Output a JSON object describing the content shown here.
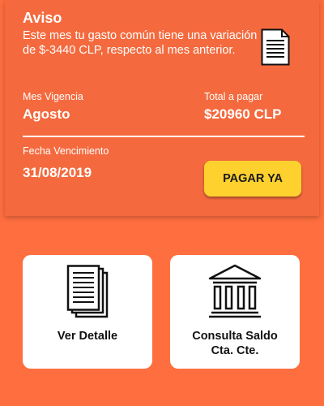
{
  "notice": {
    "title": "Aviso",
    "message": "Este mes tu gasto común tiene una variación de $-3440 CLP, respecto al mes anterior."
  },
  "billing": {
    "month_label": "Mes Vigencia",
    "month_value": "Agosto",
    "total_label": "Total a pagar",
    "total_value": "$20960 CLP",
    "due_label": "Fecha Vencimiento",
    "due_value": "31/08/2019",
    "pay_button": "PAGAR YA"
  },
  "tiles": {
    "detail_label": "Ver Detalle",
    "balance_line1": "Consulta Saldo",
    "balance_line2": "Cta. Cte."
  },
  "icons": {
    "notice": "document-icon",
    "detail": "documents-stack-icon",
    "balance": "bank-icon"
  },
  "colors": {
    "background": "#FF6E3F",
    "card": "#F46A3E",
    "button": "#FFD12E",
    "text_light": "#FFFFFF"
  }
}
